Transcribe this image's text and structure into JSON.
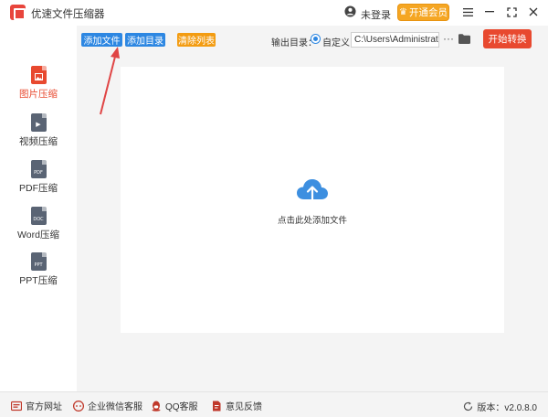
{
  "app": {
    "title": "优速文件压缩器",
    "login_text": "未登录",
    "vip_label": "开通会员",
    "window_controls": [
      "menu-icon",
      "minimize-icon",
      "maximize-icon",
      "close-icon"
    ]
  },
  "toolbar": {
    "add_file": "添加文件",
    "add_folder": "添加目录",
    "clear_list": "清除列表",
    "output_label": "输出目录：",
    "custom_option": "自定义",
    "output_path": "C:\\Users\\Administrator\\",
    "more": "···",
    "start": "开始转换"
  },
  "sidebar": {
    "items": [
      {
        "label": "图片压缩",
        "icon": "image-file-icon",
        "tag": "",
        "color": "#e8492f",
        "active": true
      },
      {
        "label": "视频压缩",
        "icon": "video-file-icon",
        "tag": "▶",
        "color": "#5a6474",
        "active": false
      },
      {
        "label": "PDF压缩",
        "icon": "pdf-file-icon",
        "tag": "PDF",
        "color": "#5a6474",
        "active": false
      },
      {
        "label": "Word压缩",
        "icon": "word-file-icon",
        "tag": "DOC",
        "color": "#5a6474",
        "active": false
      },
      {
        "label": "PPT压缩",
        "icon": "ppt-file-icon",
        "tag": "PPT",
        "color": "#5a6474",
        "active": false
      }
    ]
  },
  "main": {
    "drop_text": "点击此处添加文件",
    "cloud_color": "#3d8fe0"
  },
  "footer": {
    "website": "官方网址",
    "wechat_service": "企业微信客服",
    "qq_service": "QQ客服",
    "feedback": "意见反馈",
    "version": "版本：v2.0.8.0"
  },
  "colors": {
    "accent_blue": "#2d87e2",
    "accent_orange": "#f39c12",
    "accent_red": "#e8492f",
    "vip_orange": "#f5a623"
  }
}
